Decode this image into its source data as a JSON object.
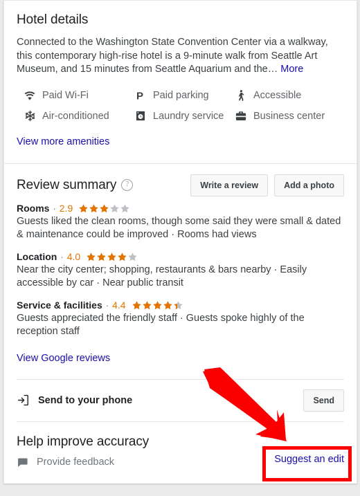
{
  "colors": {
    "accent_link": "#1a0dab",
    "star_filled": "#e37400",
    "star_empty": "#bdc1c6",
    "score_text": "#e37400",
    "annotation_red": "#ff0000",
    "card_bg": "#ffffff",
    "page_bg": "#ebebeb"
  },
  "hotel_details": {
    "title": "Hotel details",
    "description": "Connected to the Washington State Convention Center via a walkway, this contemporary high-rise hotel is a 9-minute walk from Seattle Art Museum, and 15 minutes from Seattle Aquarium and the…",
    "more_label": "More",
    "amenities": [
      {
        "icon": "wifi-icon",
        "label": "Paid Wi-Fi"
      },
      {
        "icon": "parking-icon",
        "label": "Paid parking"
      },
      {
        "icon": "accessible-icon",
        "label": "Accessible"
      },
      {
        "icon": "snowflake-icon",
        "label": "Air-conditioned"
      },
      {
        "icon": "laundry-icon",
        "label": "Laundry service"
      },
      {
        "icon": "briefcase-icon",
        "label": "Business center"
      }
    ],
    "view_more_amenities": "View more amenities"
  },
  "review_summary": {
    "title": "Review summary",
    "help_icon": "question-mark-icon",
    "write_review_label": "Write a review",
    "add_photo_label": "Add a photo",
    "categories": [
      {
        "name": "Rooms",
        "score": "2.9",
        "stars": 2.9,
        "description": "Guests liked the clean rooms, though some said they were small & dated & maintenance could be improved · Rooms had views"
      },
      {
        "name": "Location",
        "score": "4.0",
        "stars": 4.0,
        "description": "Near the city center; shopping, restaurants & bars nearby · Easily accessible by car · Near public transit"
      },
      {
        "name": "Service & facilities",
        "score": "4.4",
        "stars": 4.4,
        "description": "Guests appreciated the friendly staff · Guests spoke highly of the reception staff"
      }
    ],
    "view_google_reviews": "View Google reviews"
  },
  "send_to_phone": {
    "icon": "send-to-device-icon",
    "label": "Send to your phone",
    "button_label": "Send"
  },
  "help_improve": {
    "title": "Help improve accuracy",
    "feedback_icon": "feedback-icon",
    "feedback_label": "Provide feedback",
    "suggest_edit_label": "Suggest an edit"
  },
  "annotations": {
    "arrow": "red-arrow-pointing-down-right",
    "highlight_box_target": "Suggest an edit"
  }
}
